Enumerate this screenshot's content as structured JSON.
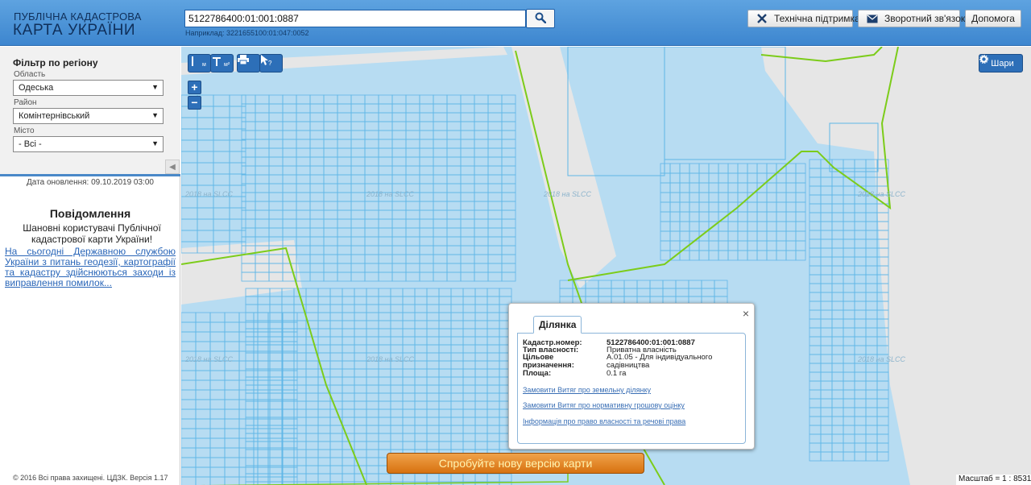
{
  "header": {
    "logo_line1": "ПУБЛІЧНА КАДАСТРОВА",
    "logo_line2": "КАРТА УКРАЇНИ",
    "search_value": "5122786400:01:001:0887",
    "search_hint": "Наприклад: 3221655100:01:047:0052",
    "buttons": {
      "support": "Технічна підтримка",
      "feedback": "Зворотний зв'язок",
      "help": "Допомога"
    },
    "icons": [
      "search-icon",
      "wrench-icon",
      "envelope-icon"
    ]
  },
  "sidebar": {
    "filter_title": "Фільтр по регіону",
    "region_label": "Область",
    "region_value": "Одеська",
    "district_label": "Район",
    "district_value": "Комінтернівський",
    "city_label": "Місто",
    "city_value": "- Всі -",
    "update_date": "Дата оновлення: 09.10.2019 03:00",
    "notice_title": "Повідомлення",
    "notice_body": "Шановні користувачі Публічної кадастрової карти України!",
    "notice_link": "На сьогодні Державною службою України з питань геодезії, картографії та кадастру здійснюються заходи із виправлення помилок...",
    "copyright": "© 2016 Всі права захищені. ЦДЗК. Версія 1.17"
  },
  "map": {
    "tools": {
      "measure_length": "м",
      "measure_area": "м²"
    },
    "zoom_in": "+",
    "zoom_out": "−",
    "layers_label": "Шари",
    "watermark": "2018 на SLCC",
    "try_new_version": "Спробуйте нову версію карти",
    "scale": "Масштаб = 1 : 8531",
    "colors": {
      "parcel_fill": "#b7dcf2",
      "parcel_line": "#5fb6e6",
      "boundary": "#7ccc1a",
      "road": "#e6e6e6"
    }
  },
  "popup": {
    "tab": "Ділянка",
    "close": "×",
    "rows": [
      {
        "key": "Кадастр.номер:",
        "value": "5122786400:01:001:0887"
      },
      {
        "key": "Тип власності:",
        "value": "Приватна власність"
      },
      {
        "key": "Цільове призначення:",
        "value": "A.01.05 - Для індивідуального садівництва"
      },
      {
        "key": "Площа:",
        "value": "0.1 га"
      }
    ],
    "links": [
      "Замовити Витяг про земельну ділянку",
      "Замовити Витяг про нормативну грошову оцінку",
      "Інформація про право власності та речові права"
    ]
  }
}
